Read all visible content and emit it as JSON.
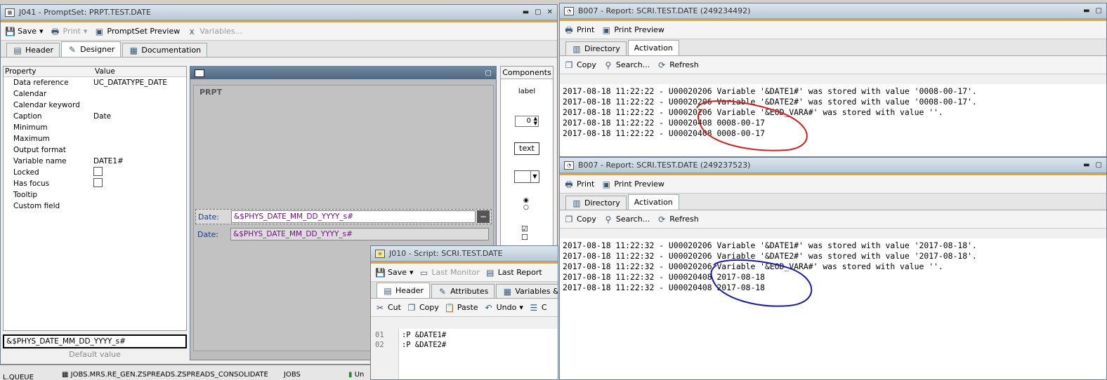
{
  "prompt_window": {
    "title": "J041 - PromptSet: PRPT.TEST.DATE",
    "toolbar": {
      "save": "Save",
      "print": "Print",
      "preview": "PromptSet Preview",
      "variables": "Variables..."
    },
    "tabs": [
      "Header",
      "Designer",
      "Documentation"
    ],
    "property_header": {
      "property": "Property",
      "value": "Value"
    },
    "properties": [
      {
        "name": "Data reference",
        "value": "UC_DATATYPE_DATE"
      },
      {
        "name": "Calendar",
        "value": ""
      },
      {
        "name": "Calendar keyword",
        "value": ""
      },
      {
        "name": "Caption",
        "value": "Date"
      },
      {
        "name": "Minimum",
        "value": ""
      },
      {
        "name": "Maximum",
        "value": ""
      },
      {
        "name": "Output format",
        "value": ""
      },
      {
        "name": "Variable name",
        "value": "DATE1#"
      },
      {
        "name": "Locked",
        "value": ""
      },
      {
        "name": "Has focus",
        "value": ""
      },
      {
        "name": "Tooltip",
        "value": ""
      },
      {
        "name": "Custom field",
        "value": ""
      }
    ],
    "default_value_input": "&$PHYS_DATE_MM_DD_YYYY_s#",
    "default_value_label": "Default value",
    "designer_group": "PRPT",
    "fields": [
      {
        "label": "Date:",
        "value": "&$PHYS_DATE_MM_DD_YYYY_s#"
      },
      {
        "label": "Date:",
        "value": "&$PHYS_DATE_MM_DD_YYYY_s#"
      }
    ],
    "components": {
      "title": "Components",
      "label": "label",
      "number": "0",
      "text": "text"
    }
  },
  "taskbar": {
    "item1": "JOBS.MRS.RE_GEN.ZSPREADS.ZSPREADS_CONSOLIDATE",
    "item2": "JOBS",
    "item0": "L.QUEUE",
    "item3": "Un"
  },
  "script_window": {
    "title": "J010 - Script: SCRI.TEST.DATE",
    "toolbar": {
      "save": "Save",
      "last_monitor": "Last Monitor",
      "last_report": "Last Report"
    },
    "tabs": [
      "Header",
      "Attributes",
      "Variables & Promp"
    ],
    "edit": {
      "cut": "Cut",
      "copy": "Copy",
      "paste": "Paste",
      "undo": "Undo",
      "more": "C"
    },
    "lines": [
      {
        "num": "01",
        "code": ":P &DATE1#"
      },
      {
        "num": "02",
        "code": ":P &DATE2#"
      }
    ]
  },
  "report1": {
    "title": "B007 - Report: SCRI.TEST.DATE (249234492)",
    "print": "Print",
    "preview": "Print Preview",
    "tabs": [
      "Directory",
      "Activation"
    ],
    "copy": "Copy",
    "search": "Search...",
    "refresh": "Refresh",
    "lines": [
      "2017-08-18 11:22:22 - U00020206 Variable '&DATE1#' was stored with value '0008-00-17'.",
      "2017-08-18 11:22:22 - U00020206 Variable '&DATE2#' was stored with value '0008-00-17'.",
      "2017-08-18 11:22:22 - U00020206 Variable '&EOD_VARA#' was stored with value ''.",
      "2017-08-18 11:22:22 - U00020408 0008-00-17",
      "2017-08-18 11:22:22 - U00020408 0008-00-17"
    ]
  },
  "report2": {
    "title": "B007 - Report: SCRI.TEST.DATE (249237523)",
    "print": "Print",
    "preview": "Print Preview",
    "tabs": [
      "Directory",
      "Activation"
    ],
    "copy": "Copy",
    "search": "Search...",
    "refresh": "Refresh",
    "lines": [
      "2017-08-18 11:22:32 - U00020206 Variable '&DATE1#' was stored with value '2017-08-18'.",
      "2017-08-18 11:22:32 - U00020206 Variable '&DATE2#' was stored with value '2017-08-18'.",
      "2017-08-18 11:22:32 - U00020206 Variable '&EOD_VARA#' was stored with value ''.",
      "2017-08-18 11:22:32 - U00020408 2017-08-18",
      "2017-08-18 11:22:32 - U00020408 2017-08-18"
    ]
  },
  "colors": {
    "annotation_red": "#d42020",
    "annotation_blue": "#1a1aa8",
    "accent": "#e9a41e",
    "prompt_var": "#7a0a8a"
  }
}
